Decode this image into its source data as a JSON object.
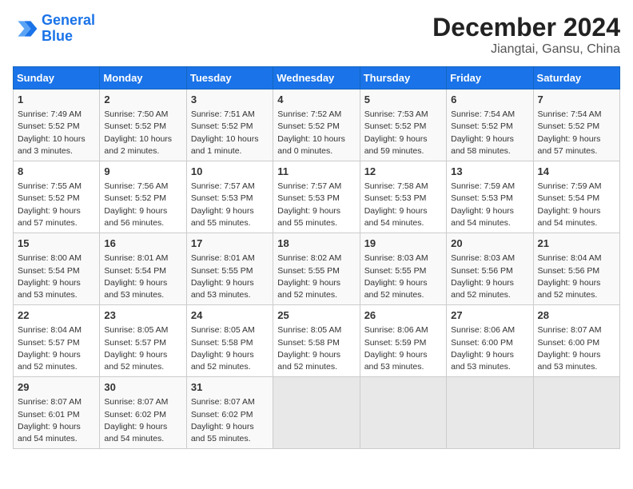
{
  "header": {
    "logo_line1": "General",
    "logo_line2": "Blue",
    "month": "December 2024",
    "location": "Jiangtai, Gansu, China"
  },
  "days_of_week": [
    "Sunday",
    "Monday",
    "Tuesday",
    "Wednesday",
    "Thursday",
    "Friday",
    "Saturday"
  ],
  "weeks": [
    [
      {
        "day": "1",
        "info": "Sunrise: 7:49 AM\nSunset: 5:52 PM\nDaylight: 10 hours\nand 3 minutes."
      },
      {
        "day": "2",
        "info": "Sunrise: 7:50 AM\nSunset: 5:52 PM\nDaylight: 10 hours\nand 2 minutes."
      },
      {
        "day": "3",
        "info": "Sunrise: 7:51 AM\nSunset: 5:52 PM\nDaylight: 10 hours\nand 1 minute."
      },
      {
        "day": "4",
        "info": "Sunrise: 7:52 AM\nSunset: 5:52 PM\nDaylight: 10 hours\nand 0 minutes."
      },
      {
        "day": "5",
        "info": "Sunrise: 7:53 AM\nSunset: 5:52 PM\nDaylight: 9 hours\nand 59 minutes."
      },
      {
        "day": "6",
        "info": "Sunrise: 7:54 AM\nSunset: 5:52 PM\nDaylight: 9 hours\nand 58 minutes."
      },
      {
        "day": "7",
        "info": "Sunrise: 7:54 AM\nSunset: 5:52 PM\nDaylight: 9 hours\nand 57 minutes."
      }
    ],
    [
      {
        "day": "8",
        "info": "Sunrise: 7:55 AM\nSunset: 5:52 PM\nDaylight: 9 hours\nand 57 minutes."
      },
      {
        "day": "9",
        "info": "Sunrise: 7:56 AM\nSunset: 5:52 PM\nDaylight: 9 hours\nand 56 minutes."
      },
      {
        "day": "10",
        "info": "Sunrise: 7:57 AM\nSunset: 5:53 PM\nDaylight: 9 hours\nand 55 minutes."
      },
      {
        "day": "11",
        "info": "Sunrise: 7:57 AM\nSunset: 5:53 PM\nDaylight: 9 hours\nand 55 minutes."
      },
      {
        "day": "12",
        "info": "Sunrise: 7:58 AM\nSunset: 5:53 PM\nDaylight: 9 hours\nand 54 minutes."
      },
      {
        "day": "13",
        "info": "Sunrise: 7:59 AM\nSunset: 5:53 PM\nDaylight: 9 hours\nand 54 minutes."
      },
      {
        "day": "14",
        "info": "Sunrise: 7:59 AM\nSunset: 5:54 PM\nDaylight: 9 hours\nand 54 minutes."
      }
    ],
    [
      {
        "day": "15",
        "info": "Sunrise: 8:00 AM\nSunset: 5:54 PM\nDaylight: 9 hours\nand 53 minutes."
      },
      {
        "day": "16",
        "info": "Sunrise: 8:01 AM\nSunset: 5:54 PM\nDaylight: 9 hours\nand 53 minutes."
      },
      {
        "day": "17",
        "info": "Sunrise: 8:01 AM\nSunset: 5:55 PM\nDaylight: 9 hours\nand 53 minutes."
      },
      {
        "day": "18",
        "info": "Sunrise: 8:02 AM\nSunset: 5:55 PM\nDaylight: 9 hours\nand 52 minutes."
      },
      {
        "day": "19",
        "info": "Sunrise: 8:03 AM\nSunset: 5:55 PM\nDaylight: 9 hours\nand 52 minutes."
      },
      {
        "day": "20",
        "info": "Sunrise: 8:03 AM\nSunset: 5:56 PM\nDaylight: 9 hours\nand 52 minutes."
      },
      {
        "day": "21",
        "info": "Sunrise: 8:04 AM\nSunset: 5:56 PM\nDaylight: 9 hours\nand 52 minutes."
      }
    ],
    [
      {
        "day": "22",
        "info": "Sunrise: 8:04 AM\nSunset: 5:57 PM\nDaylight: 9 hours\nand 52 minutes."
      },
      {
        "day": "23",
        "info": "Sunrise: 8:05 AM\nSunset: 5:57 PM\nDaylight: 9 hours\nand 52 minutes."
      },
      {
        "day": "24",
        "info": "Sunrise: 8:05 AM\nSunset: 5:58 PM\nDaylight: 9 hours\nand 52 minutes."
      },
      {
        "day": "25",
        "info": "Sunrise: 8:05 AM\nSunset: 5:58 PM\nDaylight: 9 hours\nand 52 minutes."
      },
      {
        "day": "26",
        "info": "Sunrise: 8:06 AM\nSunset: 5:59 PM\nDaylight: 9 hours\nand 53 minutes."
      },
      {
        "day": "27",
        "info": "Sunrise: 8:06 AM\nSunset: 6:00 PM\nDaylight: 9 hours\nand 53 minutes."
      },
      {
        "day": "28",
        "info": "Sunrise: 8:07 AM\nSunset: 6:00 PM\nDaylight: 9 hours\nand 53 minutes."
      }
    ],
    [
      {
        "day": "29",
        "info": "Sunrise: 8:07 AM\nSunset: 6:01 PM\nDaylight: 9 hours\nand 54 minutes."
      },
      {
        "day": "30",
        "info": "Sunrise: 8:07 AM\nSunset: 6:02 PM\nDaylight: 9 hours\nand 54 minutes."
      },
      {
        "day": "31",
        "info": "Sunrise: 8:07 AM\nSunset: 6:02 PM\nDaylight: 9 hours\nand 55 minutes."
      },
      {
        "day": "",
        "info": ""
      },
      {
        "day": "",
        "info": ""
      },
      {
        "day": "",
        "info": ""
      },
      {
        "day": "",
        "info": ""
      }
    ]
  ]
}
